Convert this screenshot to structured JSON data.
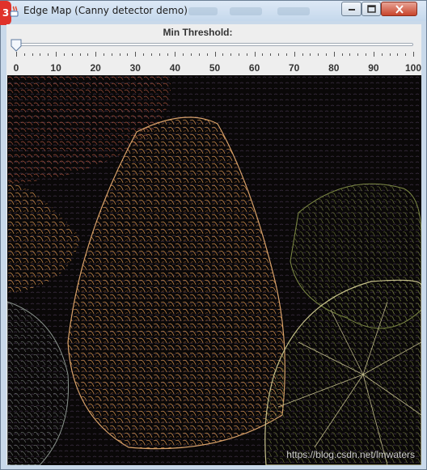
{
  "window": {
    "title": "Edge Map (Canny detector demo)",
    "badge": "3"
  },
  "slider": {
    "label": "Min Threshold:",
    "value": 0,
    "min": 0,
    "max": 100,
    "tick_labels": [
      "0",
      "10",
      "20",
      "30",
      "40",
      "50",
      "60",
      "70",
      "80",
      "90",
      "100"
    ]
  },
  "image": {
    "description_icon": "edge-map-image",
    "watermark": "https://blog.csdn.net/lmwaters"
  },
  "colors": {
    "window_frame": "#c9d9ea",
    "content_bg": "#eeeeee",
    "close_button": "#c8442b",
    "image_bg": "#0a0808"
  }
}
